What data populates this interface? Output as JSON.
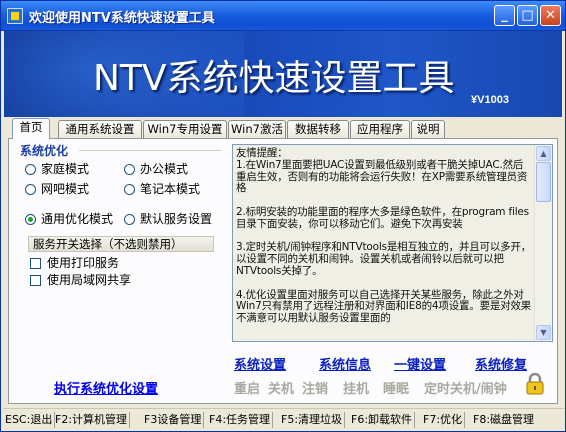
{
  "window": {
    "title": "欢迎使用NTV系统快速设置工具",
    "buttons": {
      "minimize": "_",
      "maximize": "□",
      "close": "✕"
    }
  },
  "banner": {
    "title": "NTV系统快速设置工具",
    "version": "V1003"
  },
  "tabs": [
    "首页",
    "通用系统设置",
    "Win7专用设置",
    "Win7激活",
    "数据转移",
    "应用程序",
    "说明"
  ],
  "optimize": {
    "group_title": "系统优化",
    "modes": [
      {
        "label": "家庭模式",
        "selected": false
      },
      {
        "label": "办公模式",
        "selected": false
      },
      {
        "label": "网吧模式",
        "selected": false
      },
      {
        "label": "笔记本模式",
        "selected": false
      },
      {
        "label": "通用优化模式",
        "selected": true
      },
      {
        "label": "默认服务设置",
        "selected": false
      }
    ],
    "service_header": "服务开关选择（不选则禁用）",
    "services": [
      {
        "label": "使用打印服务",
        "checked": false
      },
      {
        "label": "使用局域网共享",
        "checked": false
      }
    ],
    "execute_link": "执行系统优化设置"
  },
  "info": {
    "text": "友情提醒：\n1.在Win7里面要把UAC设置到最低级别或者干脆关掉UAC.然后重启生效，否则有的功能将会运行失败！在XP需要系统管理员资格\n\n2.标明安装的功能里面的程序大多是绿色软件，在program files目录下面安装，你可以移动它们。避免下次再安装\n\n3.定时关机/闹钟程序和NTVtools是相互独立的，并且可以多开，以设置不同的关机和闹钟。设置关机或者闹铃以后就可以把NTVtools关掉了。\n\n4.优化设置里面对服务可以自己选择开关某些服务，除此之外对Win7只有禁用了远程注册和对界面和IE8的4项设置。要是对效果不满意可以用默认服务设置里面的"
  },
  "actions": [
    "系统设置",
    "系统信息",
    "一键设置",
    "系统修复"
  ],
  "power_actions": [
    "重启",
    "关机",
    "注销",
    "挂机",
    "睡眠",
    "定时关机/闹钟"
  ],
  "lock_icon": "padlock-icon",
  "statusbar": [
    "ESC:退出",
    "F2:计算机管理",
    "F3设备管理",
    "F4:任务管理",
    "F5:清理垃圾",
    "F6:卸载软件",
    "F7:优化",
    "F8:磁盘管理"
  ]
}
